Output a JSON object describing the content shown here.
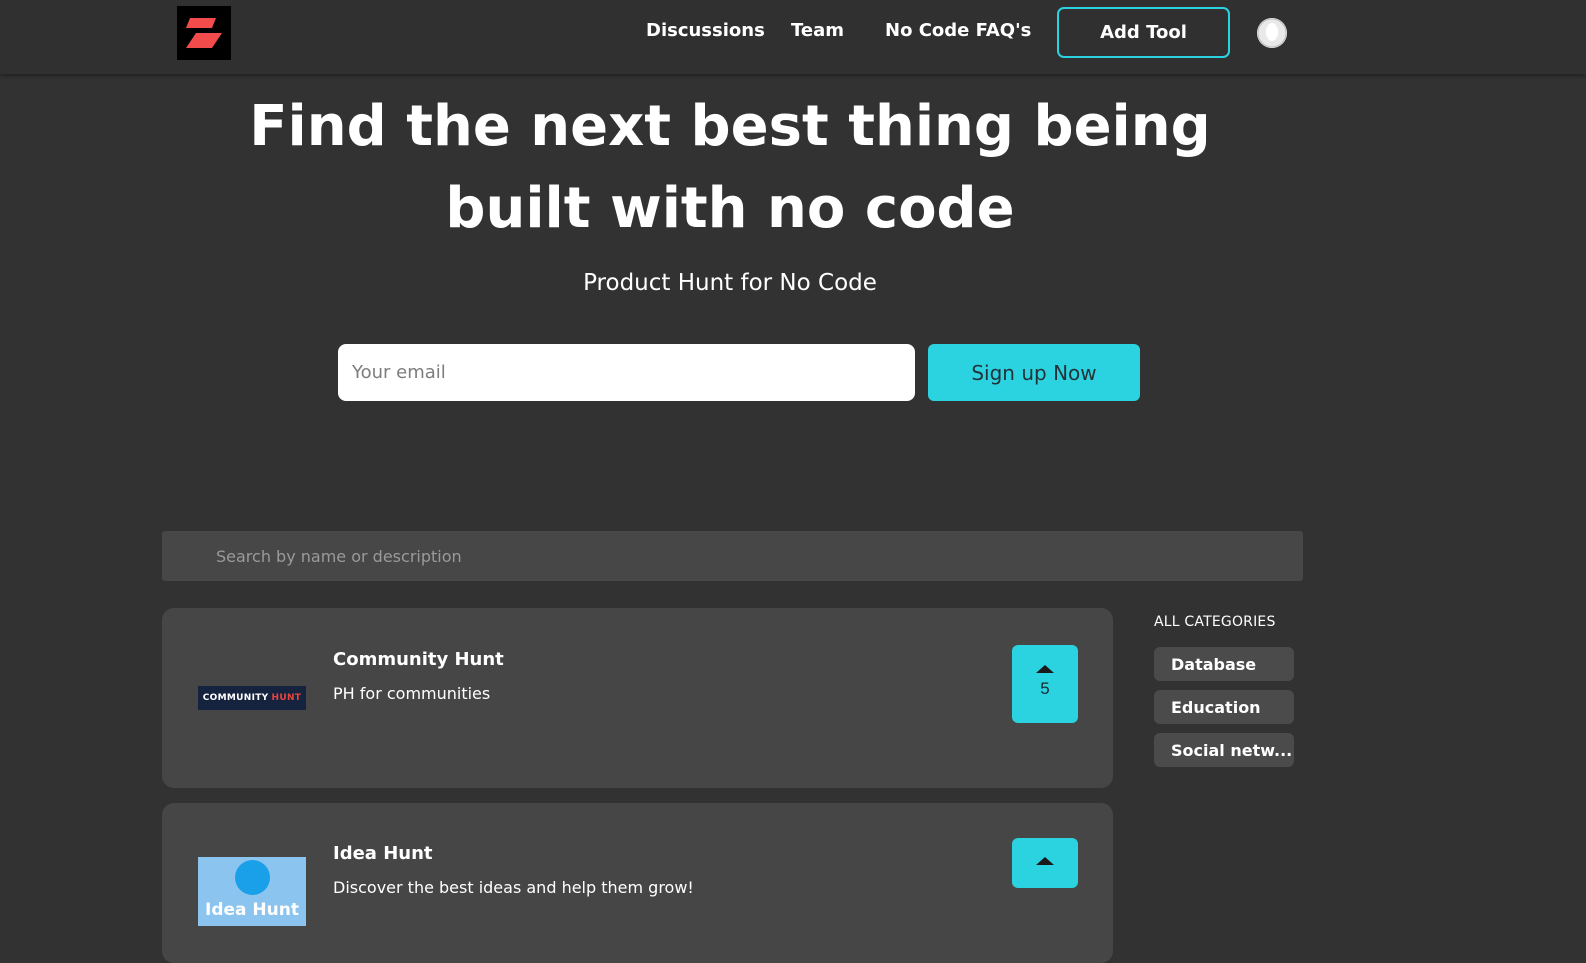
{
  "nav": {
    "logo_icon": "brand-logo-icon",
    "links": [
      "Discussions",
      "Team",
      "No Code FAQ's"
    ],
    "add_tool_label": "Add Tool",
    "avatar_icon": "user-avatar-icon"
  },
  "hero": {
    "title": "Find the next best thing being built with no code",
    "subtitle": "Product Hunt for No Code",
    "email_placeholder": "Your email",
    "signup_label": "Sign up Now"
  },
  "search": {
    "placeholder": "Search by name or description"
  },
  "products": [
    {
      "name": "Community Hunt",
      "description": "PH for communities",
      "logo_text_main": "COMMUNITY",
      "logo_text_accent": "HUNT",
      "upvotes": "5"
    },
    {
      "name": "Idea Hunt",
      "description": "Discover the best ideas and help them grow!",
      "logo_text": "Idea Hunt",
      "upvotes": ""
    }
  ],
  "categories": {
    "heading": "ALL CATEGORIES",
    "items": [
      "Database",
      "Education",
      "Social netw..."
    ]
  },
  "colors": {
    "background": "#323232",
    "accent": "#2bd2e0",
    "card": "#464646",
    "logo_red": "#f24b4b"
  }
}
